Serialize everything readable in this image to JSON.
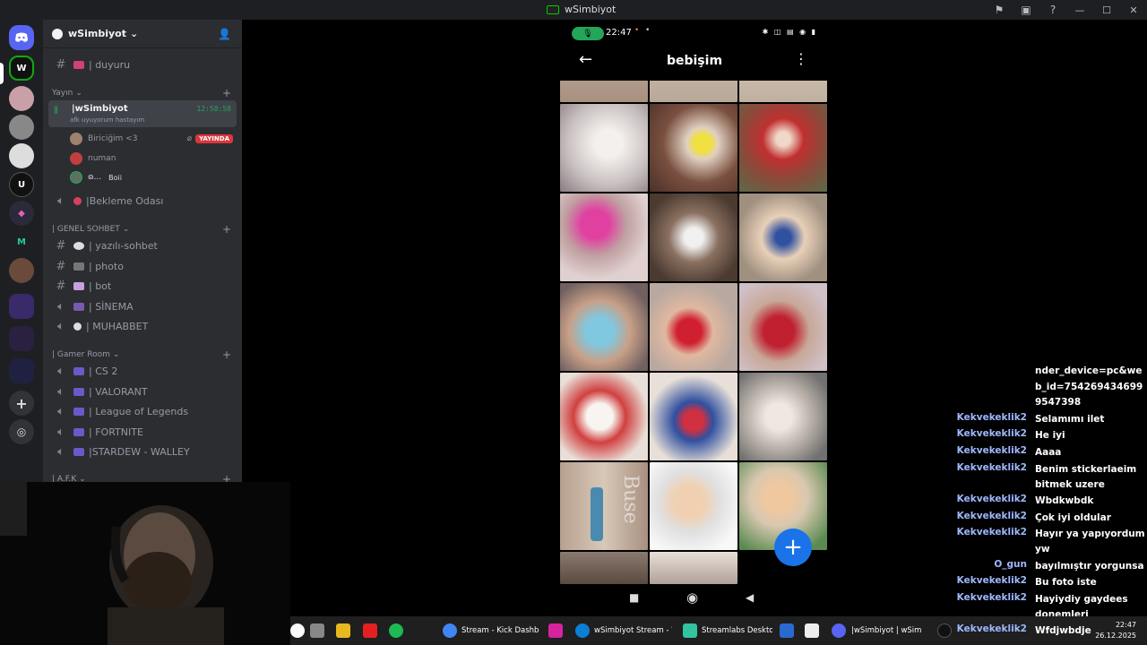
{
  "window": {
    "title": "wSimbiyot"
  },
  "server": {
    "name": "wSimbiyot"
  },
  "channels": {
    "duyuru": "| duyuru",
    "category_yayin": "Yayın",
    "live_channel": {
      "name": "|wSimbiyot",
      "subtitle": "afk uyuyorum hastayım",
      "timer": "12:58:58"
    },
    "users": [
      {
        "name": "Biriciğim <3",
        "live_badge": "YAYINDA"
      },
      {
        "name": "numan"
      },
      {
        "name": "ɷ...",
        "extra": "Boii"
      }
    ],
    "bekleme": "|Bekleme Odası",
    "category_genel": "| GENEL SOHBET",
    "genel_items": [
      "| yazılı-sohbet",
      "| photo",
      "| bot",
      "| SİNEMA",
      "| MUHABBET"
    ],
    "category_gamer": "| Gamer Room",
    "gamer_items": [
      "| CS 2",
      "| VALORANT",
      "| League of Legends",
      "| FORTNITE",
      "|STARDEW - WALLEY"
    ],
    "category_afk": "| A.F.K"
  },
  "phone": {
    "time": "22:47",
    "album_title": "bebişim",
    "fab_label": "+",
    "watermark_text": "Buse",
    "status_icons": "✱ ◫ ▤ ◉ ▮"
  },
  "chat": {
    "overflow_text": "nder_device=pc&web_id=7542694346999547398",
    "messages": [
      {
        "user": "Kekvekeklik2",
        "text": "Selamımı ilet"
      },
      {
        "user": "Kekvekeklik2",
        "text": "He iyi"
      },
      {
        "user": "Kekvekeklik2",
        "text": "Aaaa"
      },
      {
        "user": "Kekvekeklik2",
        "text": "Benim stickerlaeim bitmek uzere"
      },
      {
        "user": "Kekvekeklik2",
        "text": "Wbdkwbdk"
      },
      {
        "user": "Kekvekeklik2",
        "text": "Çok iyi oldular"
      },
      {
        "user": "Kekvekeklik2",
        "text": "Hayır ya yapıyordum yw"
      },
      {
        "user": "O_gun",
        "text": "bayılmıştır yorgunsa"
      },
      {
        "user": "Kekvekeklik2",
        "text": "Bu foto iste"
      },
      {
        "user": "Kekvekeklik2",
        "text": "Hayiydiy gaydees donemleri"
      },
      {
        "user": "Kekvekeklik2",
        "text": "Wfdjwbdje"
      }
    ]
  },
  "taskbar": {
    "items": [
      {
        "label": "Stream - Kick Dashboard",
        "color": "#4285f4"
      },
      {
        "label": "wSimbiyot Stream - Wa",
        "color": "#0b7fd4"
      },
      {
        "label": "Streamlabs Desktop",
        "color": "#31c3a2"
      },
      {
        "label": "|wSimbiyot | wSim",
        "color": "#5865f2"
      }
    ],
    "time": "22:47",
    "date": "26.12.2025"
  },
  "colors": {
    "discord_bg": "#2b2d31",
    "rail_bg": "#1e1f22",
    "live_green": "#23a55a",
    "live_red": "#da373c",
    "fab_blue": "#1a73e8",
    "chat_user": "#9fb8ff"
  }
}
